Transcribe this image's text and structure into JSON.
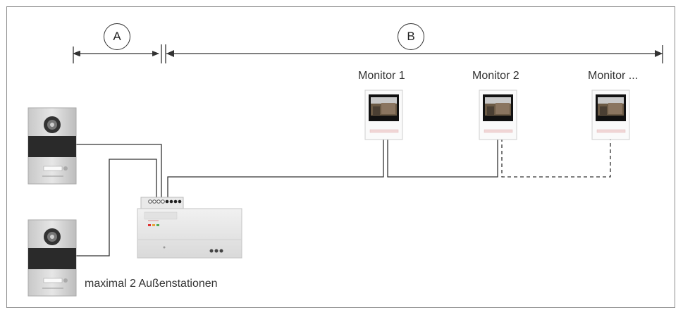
{
  "labels": {
    "range_a": "A",
    "range_b": "B",
    "monitor_1": "Monitor 1",
    "monitor_2": "Monitor 2",
    "monitor_n": "Monitor ...",
    "caption": "maximal 2 Außenstationen"
  },
  "colors": {
    "line": "#333333",
    "frame": "#8c8c8c",
    "panel_metal": "#d6d6d6",
    "panel_dark": "#2a2a2a",
    "monitor_screen": "#111111"
  },
  "icons": [
    "outdoor-station-icon",
    "monitor-icon",
    "power-supply-icon",
    "arrow-icon"
  ]
}
